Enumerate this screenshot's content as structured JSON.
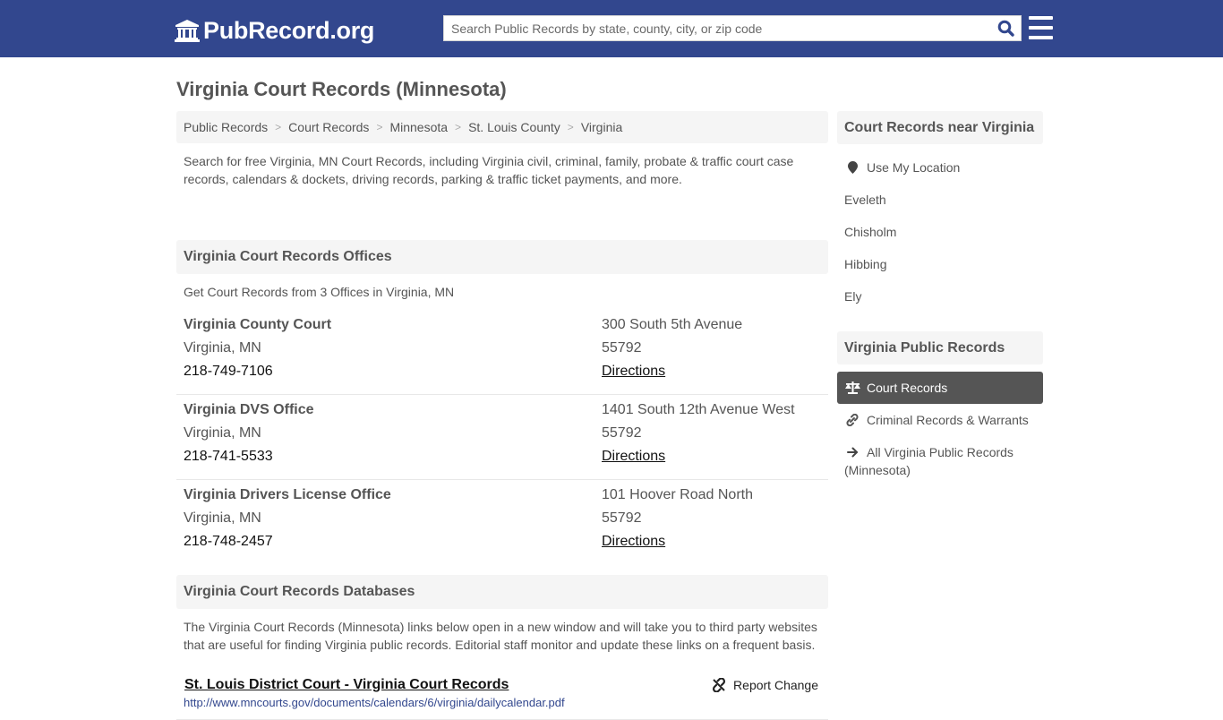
{
  "header": {
    "logo_text": "PubRecord.org",
    "search_placeholder": "Search Public Records by state, county, city, or zip code",
    "search_value": "",
    "colors": {
      "brand": "#32478e"
    }
  },
  "page": {
    "title": "Virginia Court Records (Minnesota)"
  },
  "breadcrumb": [
    {
      "label": "Public Records"
    },
    {
      "label": "Court Records"
    },
    {
      "label": "Minnesota"
    },
    {
      "label": "St. Louis County"
    },
    {
      "label": "Virginia"
    }
  ],
  "intro": "Search for free Virginia, MN Court Records, including Virginia civil, criminal, family, probate & traffic court case records, calendars & dockets, driving records, parking & traffic ticket payments, and more.",
  "offices": {
    "heading": "Virginia Court Records Offices",
    "subheading": "Get Court Records from 3 Offices in Virginia, MN",
    "items": [
      {
        "name": "Virginia County Court",
        "city": "Virginia, MN",
        "phone": "218-749-7106",
        "address": "300 South 5th Avenue",
        "zip": "55792",
        "directions": "Directions"
      },
      {
        "name": "Virginia DVS Office",
        "city": "Virginia, MN",
        "phone": "218-741-5533",
        "address": "1401 South 12th Avenue West",
        "zip": "55792",
        "directions": "Directions"
      },
      {
        "name": "Virginia Drivers License Office",
        "city": "Virginia, MN",
        "phone": "218-748-2457",
        "address": "101 Hoover Road North",
        "zip": "55792",
        "directions": "Directions"
      }
    ]
  },
  "databases": {
    "heading": "Virginia Court Records Databases",
    "description": "The Virginia Court Records (Minnesota) links below open in a new window and will take you to third party websites that are useful for finding Virginia public records. Editorial staff monitor and update these links on a frequent basis.",
    "items": [
      {
        "title": "St. Louis District Court - Virginia Court Records",
        "url": "http://www.mncourts.gov/documents/calendars/6/virginia/dailycalendar.pdf",
        "report_label": "Report Change"
      }
    ]
  },
  "sidebar": {
    "nearby": {
      "heading": "Court Records near Virginia",
      "use_location": "Use My Location",
      "cities": [
        "Eveleth",
        "Chisholm",
        "Hibbing",
        "Ely"
      ]
    },
    "public_records": {
      "heading": "Virginia Public Records",
      "items": [
        {
          "label": "Court Records",
          "icon": "balance-scale-icon",
          "active": true
        },
        {
          "label": "Criminal Records & Warrants",
          "icon": "link-icon",
          "active": false
        },
        {
          "label": "All Virginia Public Records (Minnesota)",
          "icon": "arrow-right-icon",
          "active": false
        }
      ]
    }
  }
}
